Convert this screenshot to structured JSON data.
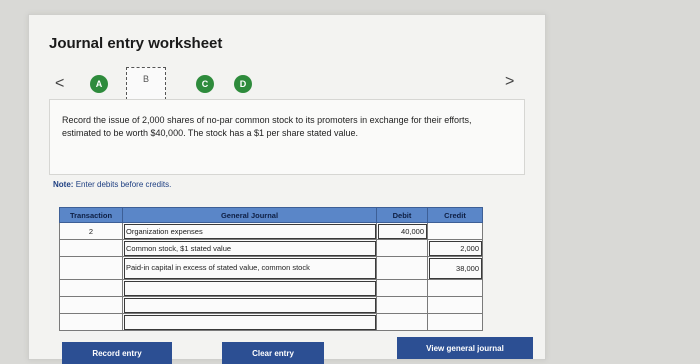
{
  "header": {
    "title": "Journal entry worksheet"
  },
  "nav": {
    "prev": "<",
    "next": ">"
  },
  "steps": [
    {
      "label": "A",
      "state": "completed"
    },
    {
      "label": "B",
      "state": "current"
    },
    {
      "label": "C",
      "state": "completed"
    },
    {
      "label": "D",
      "state": "completed"
    }
  ],
  "prompt": {
    "text": "Record the issue of 2,000 shares of no-par common stock to its promoters in exchange for their efforts, estimated to be worth $40,000. The stock has a $1 per share stated value."
  },
  "note": {
    "label": "Note:",
    "text": "Enter debits before credits."
  },
  "journal": {
    "headers": {
      "transaction": "Transaction",
      "general_journal": "General Journal",
      "debit": "Debit",
      "credit": "Credit"
    },
    "rows": [
      {
        "transaction": "2",
        "account": "Organization expenses",
        "debit": "40,000",
        "credit": ""
      },
      {
        "transaction": "",
        "account": "Common stock, $1 stated value",
        "debit": "",
        "credit": "2,000"
      },
      {
        "transaction": "",
        "account": "Paid-in capital in excess of stated value, common stock",
        "debit": "",
        "credit": "38,000"
      },
      {
        "transaction": "",
        "account": "",
        "debit": "",
        "credit": ""
      },
      {
        "transaction": "",
        "account": "",
        "debit": "",
        "credit": ""
      },
      {
        "transaction": "",
        "account": "",
        "debit": "",
        "credit": ""
      }
    ]
  },
  "buttons": {
    "record": "Record entry",
    "clear": "Clear entry",
    "view": "View general journal"
  },
  "colors": {
    "accent": "#2c4f93",
    "header_bg": "#5a86c8",
    "step_done": "#2e8b3c"
  }
}
